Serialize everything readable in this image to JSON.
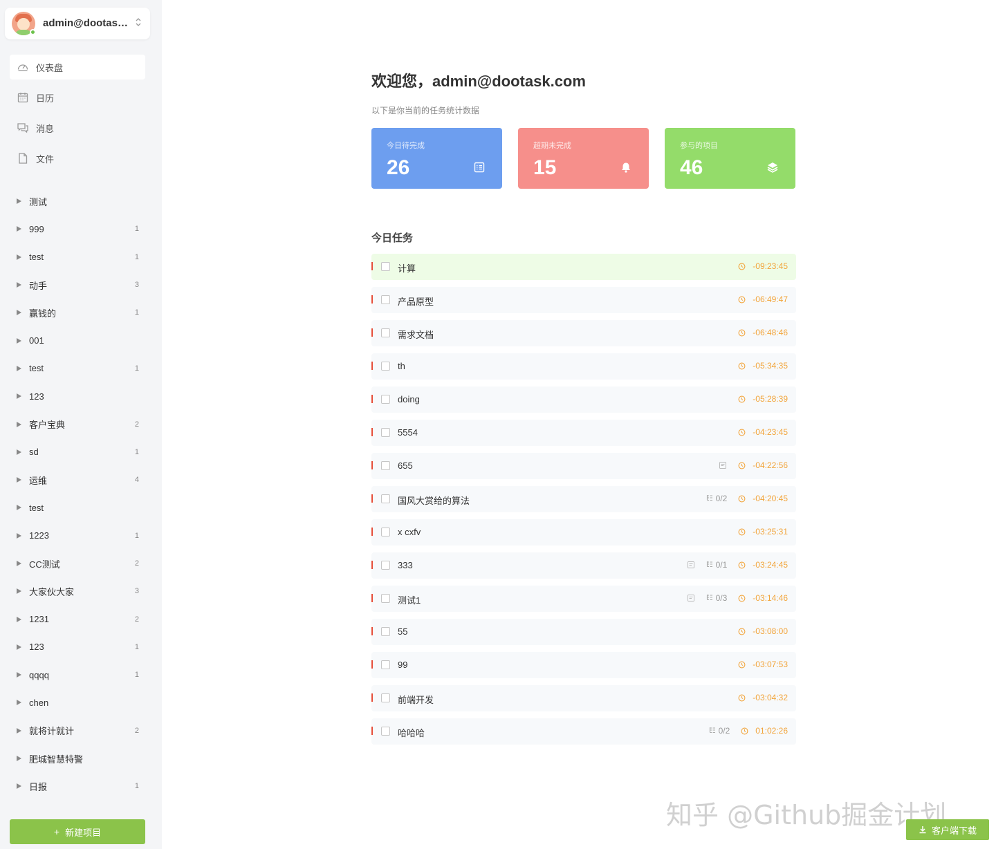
{
  "user": {
    "name": "admin@dootask.com"
  },
  "menu": [
    {
      "label": "仪表盘",
      "icon": "dashboard-icon",
      "active": true
    },
    {
      "label": "日历",
      "icon": "calendar-icon",
      "active": false
    },
    {
      "label": "消息",
      "icon": "message-icon",
      "active": false
    },
    {
      "label": "文件",
      "icon": "file-icon",
      "active": false
    }
  ],
  "projects": [
    {
      "name": "测试",
      "count": ""
    },
    {
      "name": "999",
      "count": "1"
    },
    {
      "name": "test",
      "count": "1"
    },
    {
      "name": "动手",
      "count": "3"
    },
    {
      "name": "赢钱的",
      "count": "1"
    },
    {
      "name": "001",
      "count": ""
    },
    {
      "name": "test",
      "count": "1"
    },
    {
      "name": "123",
      "count": ""
    },
    {
      "name": "客户宝典",
      "count": "2"
    },
    {
      "name": "sd",
      "count": "1"
    },
    {
      "name": "运维",
      "count": "4"
    },
    {
      "name": "test",
      "count": ""
    },
    {
      "name": "1223",
      "count": "1"
    },
    {
      "name": "CC测试",
      "count": "2"
    },
    {
      "name": "大家伙大家",
      "count": "3"
    },
    {
      "name": "1231",
      "count": "2"
    },
    {
      "name": "123",
      "count": "1"
    },
    {
      "name": "qqqq",
      "count": "1"
    },
    {
      "name": "chen",
      "count": ""
    },
    {
      "name": "就将计就计",
      "count": "2"
    },
    {
      "name": "肥城智慧特警",
      "count": ""
    },
    {
      "name": "日报",
      "count": "1"
    }
  ],
  "new_project_label": "新建项目",
  "welcome": "欢迎您，admin@dootask.com",
  "subtitle": "以下是你当前的任务统计数据",
  "stats": [
    {
      "label": "今日待完成",
      "value": "26",
      "icon": "checklist-icon",
      "color": "#6d9eef"
    },
    {
      "label": "超期未完成",
      "value": "15",
      "icon": "bell-icon",
      "color": "#f68f8b"
    },
    {
      "label": "参与的项目",
      "value": "46",
      "icon": "layers-icon",
      "color": "#94dc6a"
    }
  ],
  "today_tasks_title": "今日任务",
  "tasks": [
    {
      "name": "计算",
      "time": "-09:23:45",
      "highlight": true,
      "file": false,
      "subtasks": ""
    },
    {
      "name": "产品原型",
      "time": "-06:49:47",
      "highlight": false,
      "file": false,
      "subtasks": ""
    },
    {
      "name": "需求文档",
      "time": "-06:48:46",
      "highlight": false,
      "file": false,
      "subtasks": ""
    },
    {
      "name": "th",
      "time": "-05:34:35",
      "highlight": false,
      "file": false,
      "subtasks": ""
    },
    {
      "name": "doing",
      "time": "-05:28:39",
      "highlight": false,
      "file": false,
      "subtasks": ""
    },
    {
      "name": "5554",
      "time": "-04:23:45",
      "highlight": false,
      "file": false,
      "subtasks": ""
    },
    {
      "name": "655",
      "time": "-04:22:56",
      "highlight": false,
      "file": true,
      "subtasks": ""
    },
    {
      "name": "国风大赏给的算法",
      "time": "-04:20:45",
      "highlight": false,
      "file": false,
      "subtasks": "0/2"
    },
    {
      "name": "x cxfv",
      "time": "-03:25:31",
      "highlight": false,
      "file": false,
      "subtasks": ""
    },
    {
      "name": "333",
      "time": "-03:24:45",
      "highlight": false,
      "file": true,
      "subtasks": "0/1"
    },
    {
      "name": "测试1",
      "time": "-03:14:46",
      "highlight": false,
      "file": true,
      "subtasks": "0/3"
    },
    {
      "name": "55",
      "time": "-03:08:00",
      "highlight": false,
      "file": false,
      "subtasks": ""
    },
    {
      "name": "99",
      "time": "-03:07:53",
      "highlight": false,
      "file": false,
      "subtasks": ""
    },
    {
      "name": "前端开发",
      "time": "-03:04:32",
      "highlight": false,
      "file": false,
      "subtasks": ""
    },
    {
      "name": "哈哈哈",
      "time": "01:02:26",
      "highlight": false,
      "file": false,
      "subtasks": "0/2"
    }
  ],
  "watermark": "知乎 @Github掘金计划",
  "download_label": "客户端下载"
}
